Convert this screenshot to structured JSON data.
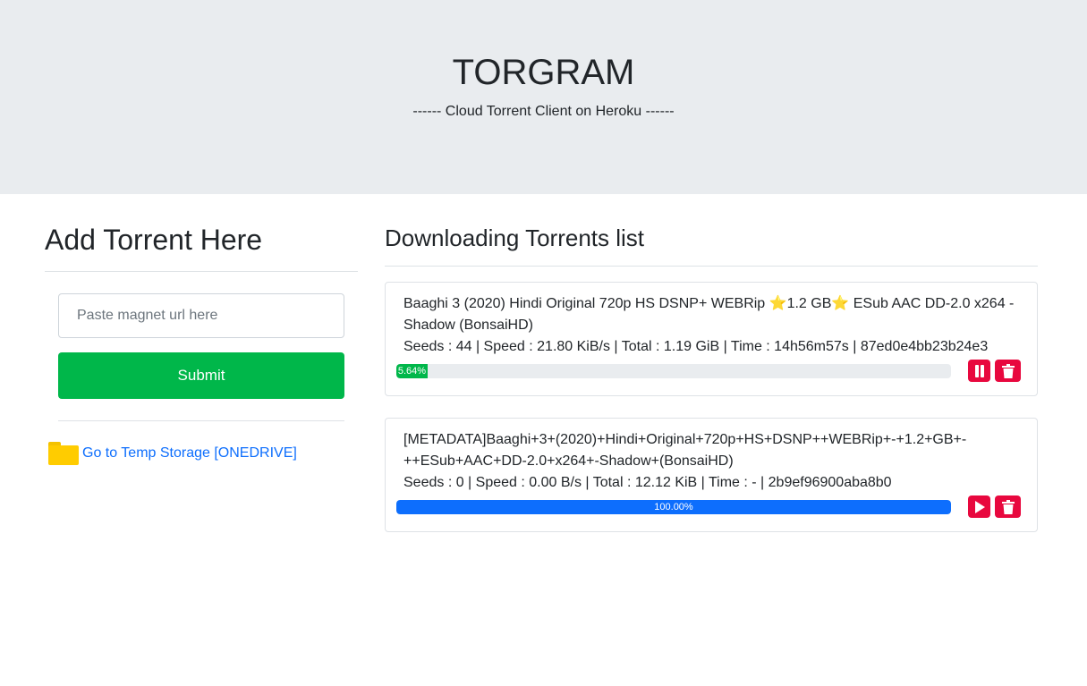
{
  "header": {
    "title": "TORGRAM",
    "subtitle": "------ Cloud Torrent Client on Heroku ------"
  },
  "add_section": {
    "title": "Add Torrent Here",
    "input_placeholder": "Paste magnet url here",
    "submit_label": "Submit",
    "storage_link_label": "Go to Temp Storage [ONEDRIVE]",
    "storage_icon": "folder-icon"
  },
  "list_section": {
    "title": "Downloading Torrents list"
  },
  "torrents": [
    {
      "name": "Baaghi 3 (2020) Hindi Original 720p HS DSNP+ WEBRip ⭐1.2 GB⭐ ESub AAC DD-2.0 x264 - Shadow (BonsaiHD)",
      "stats": "Seeds : 44 | Speed : 21.80 KiB/s | Total : 1.19 GiB | Time : 14h56m57s | 87ed0e4bb23b24e3",
      "progress_label": "5.64%",
      "progress_fraction": 0.0564,
      "bar_color": "#00b74a",
      "action_icon": "pause-icon",
      "delete_icon": "trash-icon"
    },
    {
      "name": "[METADATA]Baaghi+3+(2020)+Hindi+Original+720p+HS+DSNP++WEBRip+-+1.2+GB+-++ESub+AAC+DD-2.0+x264+-Shadow+(BonsaiHD)",
      "stats": "Seeds : 0 | Speed : 0.00 B/s | Total : 12.12 KiB | Time : - | 2b9ef96900aba8b0",
      "progress_label": "100.00%",
      "progress_fraction": 1.0,
      "bar_color": "#0d6efd",
      "action_icon": "play-icon",
      "delete_icon": "trash-icon"
    }
  ]
}
